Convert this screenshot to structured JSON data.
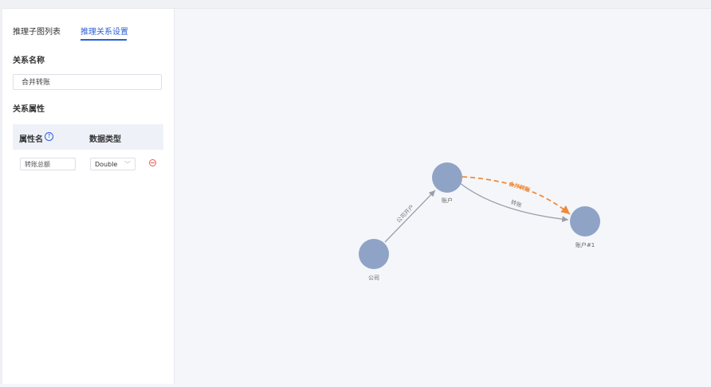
{
  "tabs": [
    {
      "label": "推理子图列表",
      "active": false
    },
    {
      "label": "推理关系设置",
      "active": true
    }
  ],
  "relation_name_label": "关系名称",
  "relation_name_value": "合并转账",
  "relation_props_label": "关系属性",
  "table": {
    "col_name": "属性名",
    "col_type": "数据类型",
    "rows": [
      {
        "name": "转账总额",
        "type": "Double"
      }
    ]
  },
  "graph": {
    "nodes": {
      "company": "公司",
      "account": "账户",
      "account1": "账户#1"
    },
    "edges": {
      "open_account": "公司开户",
      "transfer": "转账",
      "merged_transfer": "合并转账"
    },
    "colors": {
      "node": "#8fa3c6",
      "edge": "#9a9ea8",
      "inferred_edge": "#ee8b3a"
    }
  },
  "accent": "#2b5fd9"
}
